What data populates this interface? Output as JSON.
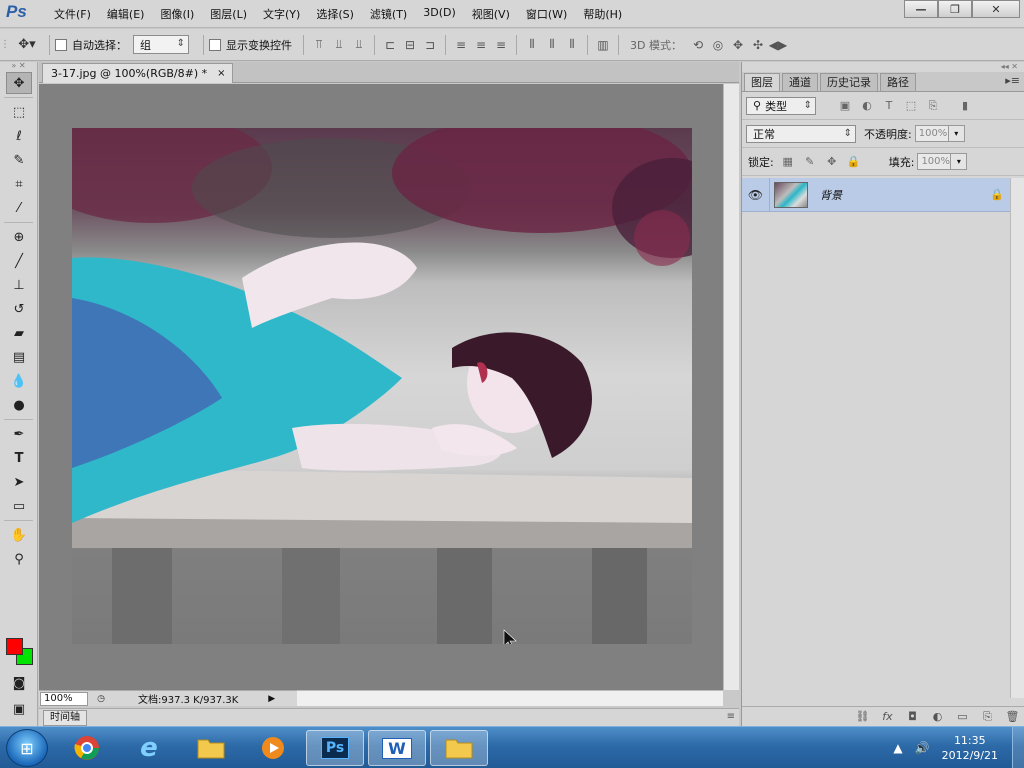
{
  "app": {
    "logo": "Ps"
  },
  "menu": [
    "文件(F)",
    "编辑(E)",
    "图像(I)",
    "图层(L)",
    "文字(Y)",
    "选择(S)",
    "滤镜(T)",
    "3D(D)",
    "视图(V)",
    "窗口(W)",
    "帮助(H)"
  ],
  "window_controls": {
    "minimize": "—",
    "restore": "❐",
    "close": "✕"
  },
  "options": {
    "auto_select_label": "自动选择：",
    "auto_select_value": "组",
    "show_transform_label": "显示变换控件",
    "mode3d_label": "3D 模式："
  },
  "document": {
    "tab_title": "3-17.jpg @ 100%(RGB/8#) *",
    "tab_close": "×"
  },
  "status": {
    "zoom": "100%",
    "doc_size": "文档:937.3 K/937.3K"
  },
  "timeline": {
    "tab_label": "时间轴"
  },
  "panel": {
    "tabs": [
      "图层",
      "通道",
      "历史记录",
      "路径"
    ],
    "filter_label": "类型",
    "blend_mode": "正常",
    "opacity_label": "不透明度:",
    "opacity_value": "100%",
    "lock_label": "锁定:",
    "fill_label": "填充:",
    "fill_value": "100%",
    "layers": [
      {
        "name": "背景",
        "visible": true,
        "locked": true
      }
    ]
  },
  "taskbar": {
    "apps": [
      "chrome",
      "ie",
      "explorer",
      "media",
      "photoshop",
      "word",
      "folder"
    ],
    "photoshop_label": "Ps",
    "word_label": "W",
    "ie_label": "e"
  },
  "tray": {
    "time": "11:35",
    "date": "2012/9/21"
  },
  "colors": {
    "foreground": "#ff0000",
    "background": "#00e400",
    "taskbar": "#2d6aa8",
    "selected_layer": "#b9cbe6"
  }
}
